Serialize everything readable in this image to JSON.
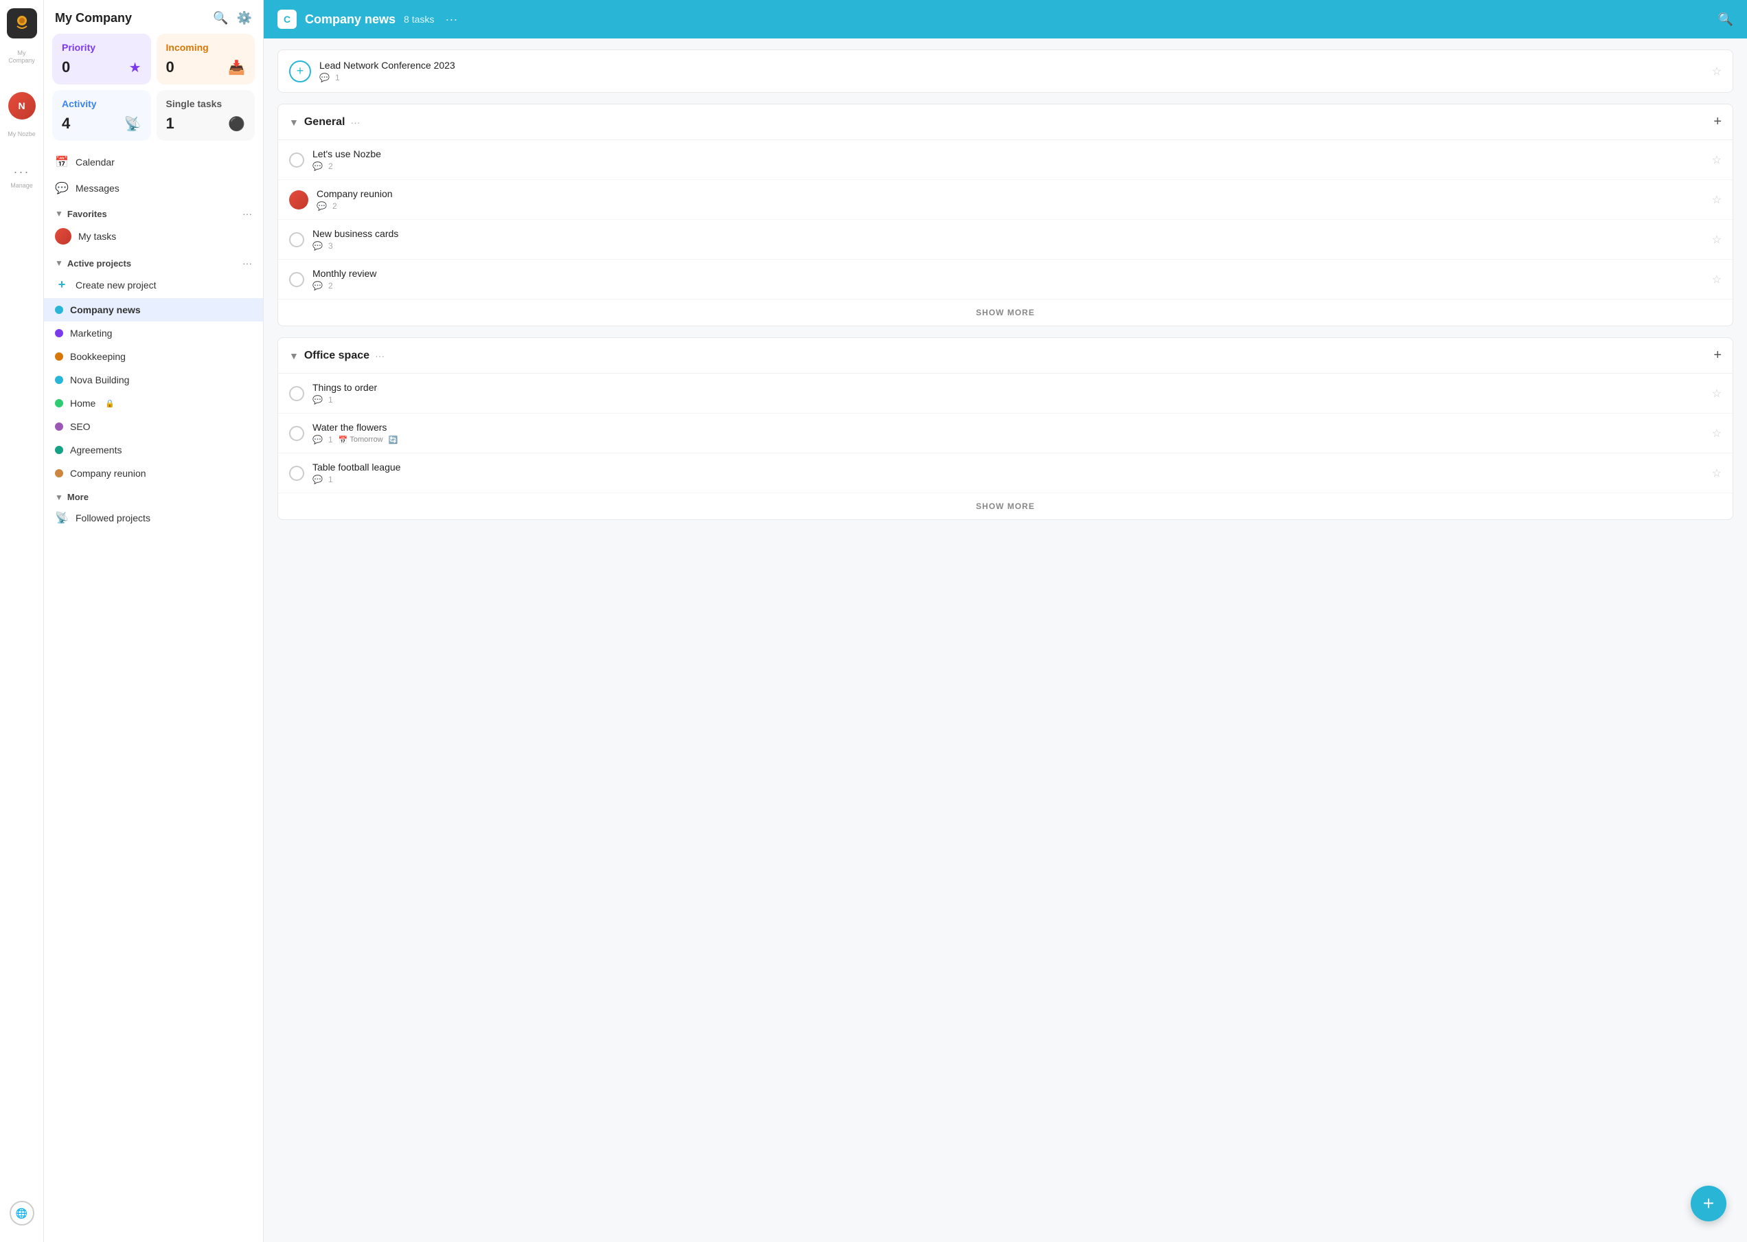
{
  "app": {
    "name": "My Company",
    "icon_text": "N"
  },
  "icon_bar": {
    "app_label": "My Company",
    "manage_label": "Manage",
    "globe_icon": "🌐"
  },
  "sidebar": {
    "title": "My Company",
    "search_tooltip": "Search",
    "settings_tooltip": "Settings",
    "cards": [
      {
        "id": "priority",
        "title": "Priority",
        "count": "0",
        "icon": "★",
        "type": "priority"
      },
      {
        "id": "incoming",
        "title": "Incoming",
        "count": "0",
        "icon": "📥",
        "type": "incoming"
      },
      {
        "id": "activity",
        "title": "Activity",
        "count": "4",
        "icon": "📡",
        "type": "activity"
      },
      {
        "id": "single",
        "title": "Single tasks",
        "count": "1",
        "icon": "⚫",
        "type": "single"
      }
    ],
    "nav_items": [
      {
        "id": "calendar",
        "icon": "📅",
        "label": "Calendar"
      },
      {
        "id": "messages",
        "icon": "💬",
        "label": "Messages"
      }
    ],
    "favorites": {
      "label": "Favorites",
      "items": [
        {
          "id": "my-tasks",
          "label": "My tasks",
          "avatar": true
        }
      ]
    },
    "active_projects": {
      "label": "Active projects",
      "items": [
        {
          "id": "create-new",
          "label": "Create new project",
          "icon": "+",
          "color": null
        },
        {
          "id": "company-news",
          "label": "Company news",
          "color": "#29b6d6",
          "active": true
        },
        {
          "id": "marketing",
          "label": "Marketing",
          "color": "#7c3aed"
        },
        {
          "id": "bookkeeping",
          "label": "Bookkeeping",
          "color": "#d97706"
        },
        {
          "id": "nova-building",
          "label": "Nova Building",
          "color": "#29b6d6"
        },
        {
          "id": "home",
          "label": "Home",
          "color": "#2ecc71",
          "lock": true
        },
        {
          "id": "seo",
          "label": "SEO",
          "color": "#9b59b6"
        },
        {
          "id": "agreements",
          "label": "Agreements",
          "color": "#16a085"
        },
        {
          "id": "company-reunion",
          "label": "Company reunion",
          "color": "#cd853f"
        }
      ]
    },
    "more": {
      "label": "More",
      "items": [
        {
          "id": "followed-projects",
          "label": "Followed projects",
          "icon": "📡"
        }
      ]
    }
  },
  "main": {
    "header": {
      "project_icon": "C",
      "project_name": "Company news",
      "task_count": "8 tasks",
      "dots_label": "···",
      "search_icon": "🔍"
    },
    "top_task": {
      "title": "Lead Network Conference 2023",
      "comment_count": "1"
    },
    "sections": [
      {
        "id": "general",
        "name": "General",
        "tasks": [
          {
            "id": "lets-use-nozbe",
            "title": "Let's use Nozbe",
            "comments": "2",
            "has_avatar": true
          },
          {
            "id": "company-reunion",
            "title": "Company reunion",
            "comments": "2",
            "has_avatar": true
          },
          {
            "id": "new-business-cards",
            "title": "New business cards",
            "comments": "3",
            "has_avatar": false
          },
          {
            "id": "monthly-review",
            "title": "Monthly review",
            "comments": "2",
            "has_avatar": false
          }
        ],
        "show_more": "SHOW MORE"
      },
      {
        "id": "office-space",
        "name": "Office space",
        "tasks": [
          {
            "id": "things-to-order",
            "title": "Things to order",
            "comments": "1",
            "has_avatar": false
          },
          {
            "id": "water-the-flowers",
            "title": "Water the flowers",
            "comments": "1",
            "due": "Tomorrow",
            "recurring": true,
            "has_avatar": false
          },
          {
            "id": "table-football-league",
            "title": "Table football league",
            "comments": "1",
            "has_avatar": false
          }
        ],
        "show_more": "SHOW MORE"
      }
    ],
    "fab_label": "+"
  }
}
